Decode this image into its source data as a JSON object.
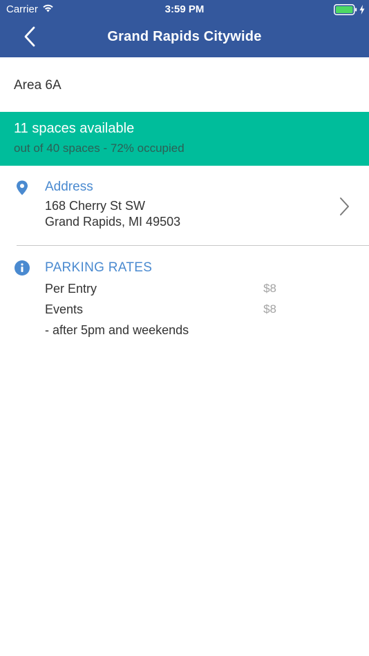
{
  "status_bar": {
    "carrier": "Carrier",
    "time": "3:59 PM",
    "icons": [
      "wifi-icon",
      "battery-icon",
      "charging-bolt-icon"
    ]
  },
  "nav": {
    "title": "Grand Rapids Citywide",
    "back_icon": "back-chevron-icon"
  },
  "area": {
    "name": "Area 6A"
  },
  "availability": {
    "headline": "11 spaces available",
    "detail": "out of 40 spaces - 72% occupied",
    "background_color": "#00bd9b"
  },
  "address": {
    "heading": "Address",
    "line1": "168 Cherry St SW",
    "line2": "Grand Rapids, MI 49503",
    "icon": "location-pin-icon",
    "chevron_icon": "chevron-right-icon"
  },
  "rates": {
    "heading": "PARKING RATES",
    "icon": "info-icon",
    "items": [
      {
        "label": "Per Entry",
        "price": "$8"
      },
      {
        "label": "Events",
        "price": "$8"
      }
    ],
    "note": "- after 5pm and weekends"
  },
  "colors": {
    "header": "#34589d",
    "accent": "#4a8ad0",
    "available": "#00bd9b",
    "battery_fill": "#4cd964"
  }
}
